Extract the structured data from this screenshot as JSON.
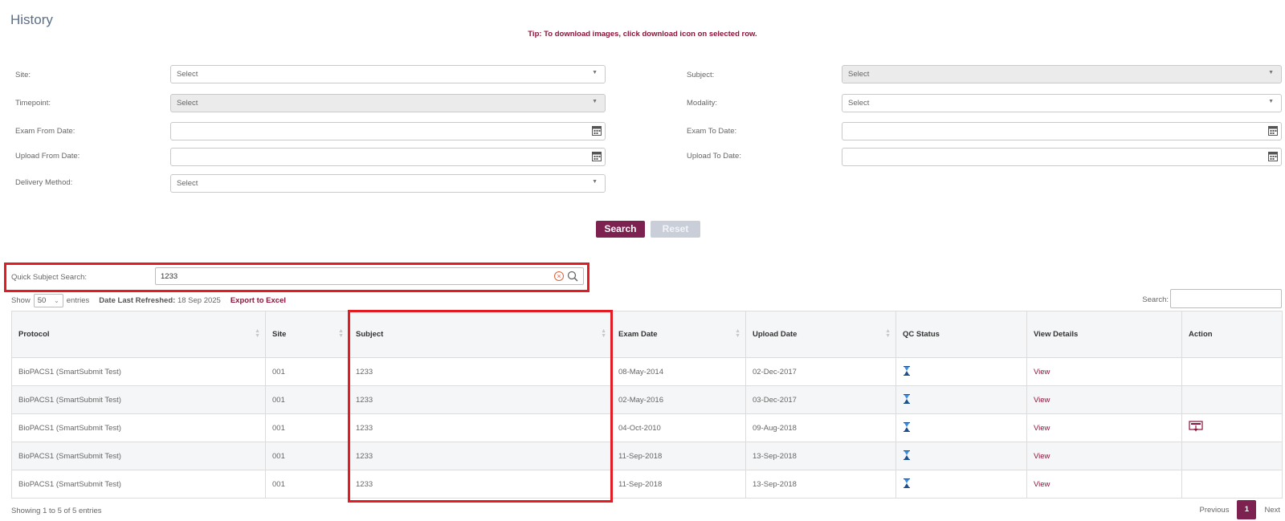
{
  "page": {
    "title": "History",
    "tip": "Tip: To download images, click download icon on selected row."
  },
  "filters": {
    "site": {
      "label": "Site:",
      "value": "Select"
    },
    "subject": {
      "label": "Subject:",
      "value": "Select"
    },
    "timepoint": {
      "label": "Timepoint:",
      "value": "Select"
    },
    "modality": {
      "label": "Modality:",
      "value": "Select"
    },
    "exam_from": {
      "label": "Exam From Date:",
      "value": ""
    },
    "exam_to": {
      "label": "Exam To Date:",
      "value": ""
    },
    "upload_from": {
      "label": "Upload From Date:",
      "value": ""
    },
    "upload_to": {
      "label": "Upload To Date:",
      "value": ""
    },
    "delivery": {
      "label": "Delivery Method:",
      "value": "Select"
    }
  },
  "buttons": {
    "search": "Search",
    "reset": "Reset"
  },
  "quick_search": {
    "label": "Quick Subject Search:",
    "value": "1233"
  },
  "toolbar": {
    "show_label": "Show",
    "show_value": "50",
    "entries_label": "entries",
    "refreshed_label": "Date Last Refreshed:",
    "refreshed_value": "18 Sep 2025",
    "export": "Export to Excel",
    "search_label": "Search:"
  },
  "table": {
    "headers": [
      "Protocol",
      "Site",
      "Subject",
      "Exam Date",
      "Upload Date",
      "QC Status",
      "View Details",
      "Action"
    ],
    "rows": [
      {
        "protocol": "BioPACS1 (SmartSubmit Test)",
        "site": "001",
        "subject": "1233",
        "exam_date": "08-May-2014",
        "upload_date": "02-Dec-2017",
        "view": "View",
        "action": ""
      },
      {
        "protocol": "BioPACS1 (SmartSubmit Test)",
        "site": "001",
        "subject": "1233",
        "exam_date": "02-May-2016",
        "upload_date": "03-Dec-2017",
        "view": "View",
        "action": ""
      },
      {
        "protocol": "BioPACS1 (SmartSubmit Test)",
        "site": "001",
        "subject": "1233",
        "exam_date": "04-Oct-2010",
        "upload_date": "09-Aug-2018",
        "view": "View",
        "action": "download-icon"
      },
      {
        "protocol": "BioPACS1 (SmartSubmit Test)",
        "site": "001",
        "subject": "1233",
        "exam_date": "11-Sep-2018",
        "upload_date": "13-Sep-2018",
        "view": "View",
        "action": ""
      },
      {
        "protocol": "BioPACS1 (SmartSubmit Test)",
        "site": "001",
        "subject": "1233",
        "exam_date": "11-Sep-2018",
        "upload_date": "13-Sep-2018",
        "view": "View",
        "action": ""
      }
    ]
  },
  "footer": {
    "info": "Showing 1 to 5 of 5 entries",
    "previous": "Previous",
    "page": "1",
    "next": "Next"
  },
  "colors": {
    "accent": "#7d2150",
    "highlight": "#e31b23",
    "link": "#8a1538"
  },
  "icons": {
    "qc_status": "hourglass-icon",
    "date": "calendar-icon",
    "search": "magnifier-icon",
    "clear": "clear-x-icon"
  }
}
